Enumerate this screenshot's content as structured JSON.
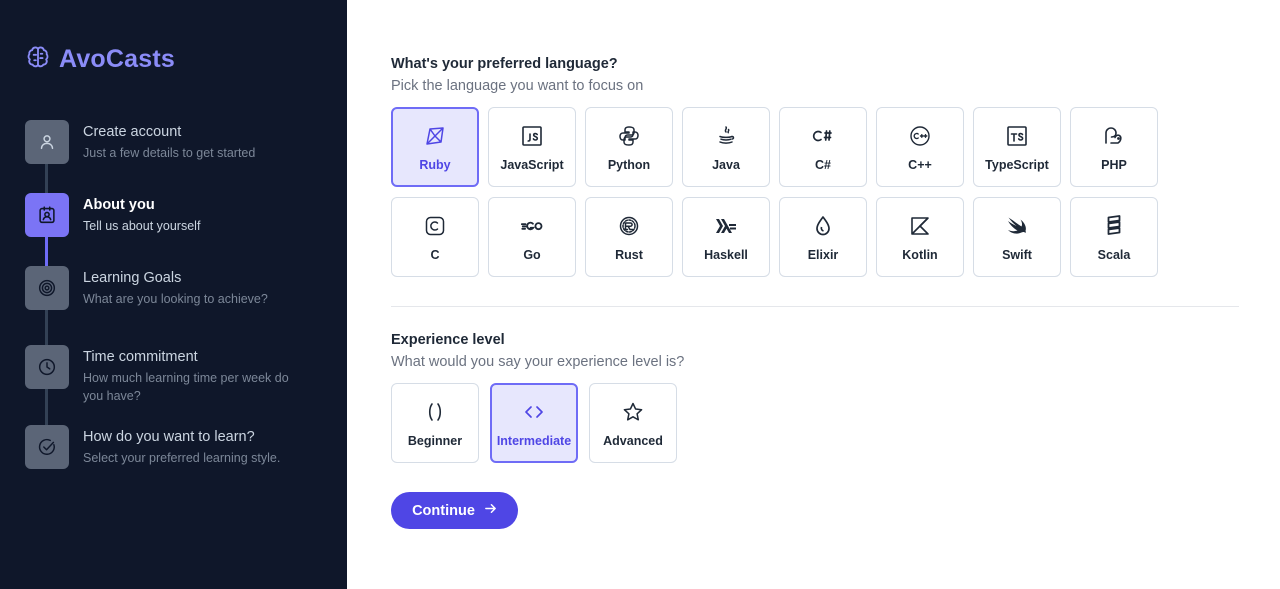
{
  "brand": {
    "name": "AvoCasts",
    "icon": "brain-icon",
    "color": "#8b8cf8"
  },
  "steps": [
    {
      "title": "Create account",
      "desc": "Just a few details to get started",
      "icon": "user-icon",
      "state": "done"
    },
    {
      "title": "About you",
      "desc": "Tell us about yourself",
      "icon": "contact-card-icon",
      "state": "current"
    },
    {
      "title": "Learning Goals",
      "desc": "What are you looking to achieve?",
      "icon": "target-icon",
      "state": "upcoming"
    },
    {
      "title": "Time commitment",
      "desc": "How much learning time per week do you have?",
      "icon": "clock-icon",
      "state": "upcoming"
    },
    {
      "title": "How do you want to learn?",
      "desc": "Select your preferred learning style.",
      "icon": "check-circle-icon",
      "state": "upcoming"
    }
  ],
  "language": {
    "title": "What's your preferred language?",
    "subtitle": "Pick the language you want to focus on",
    "selected": "Ruby",
    "options": [
      {
        "label": "Ruby",
        "icon": "ruby-icon"
      },
      {
        "label": "JavaScript",
        "icon": "javascript-icon"
      },
      {
        "label": "Python",
        "icon": "python-icon"
      },
      {
        "label": "Java",
        "icon": "java-icon"
      },
      {
        "label": "C#",
        "icon": "csharp-icon"
      },
      {
        "label": "C++",
        "icon": "cpp-icon"
      },
      {
        "label": "TypeScript",
        "icon": "typescript-icon"
      },
      {
        "label": "PHP",
        "icon": "php-icon"
      },
      {
        "label": "C",
        "icon": "c-icon"
      },
      {
        "label": "Go",
        "icon": "go-icon"
      },
      {
        "label": "Rust",
        "icon": "rust-icon"
      },
      {
        "label": "Haskell",
        "icon": "haskell-icon"
      },
      {
        "label": "Elixir",
        "icon": "elixir-icon"
      },
      {
        "label": "Kotlin",
        "icon": "kotlin-icon"
      },
      {
        "label": "Swift",
        "icon": "swift-icon"
      },
      {
        "label": "Scala",
        "icon": "scala-icon"
      }
    ]
  },
  "experience": {
    "title": "Experience level",
    "subtitle": "What would you say your experience level is?",
    "selected": "Intermediate",
    "options": [
      {
        "label": "Beginner",
        "icon": "parentheses-icon"
      },
      {
        "label": "Intermediate",
        "icon": "code-brackets-icon"
      },
      {
        "label": "Advanced",
        "icon": "star-icon"
      }
    ]
  },
  "continue_button": {
    "label": "Continue",
    "icon": "arrow-right-icon"
  },
  "colors": {
    "sidebar": "#0f172a",
    "accent": "#4f46e5",
    "accent_light": "#6f6cf6",
    "selected_bg": "#e7e7fd"
  }
}
